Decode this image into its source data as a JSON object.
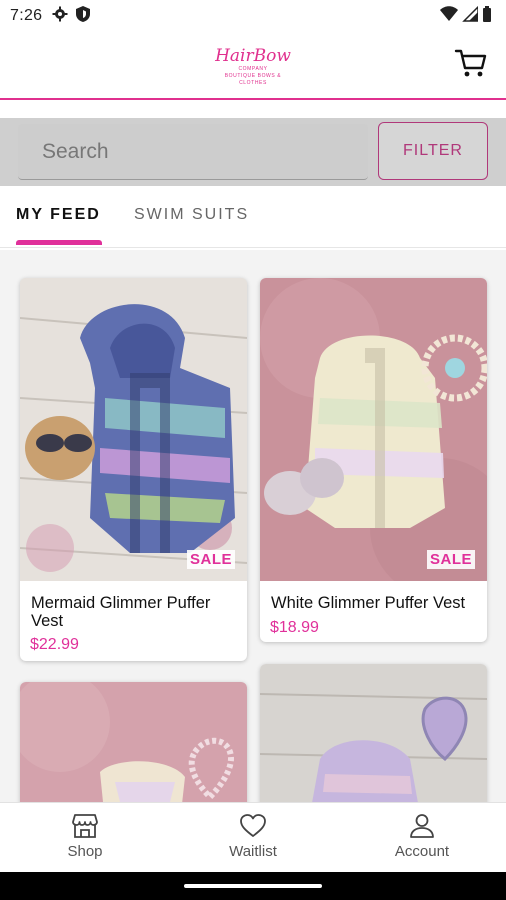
{
  "status_bar": {
    "time": "7:26"
  },
  "header": {
    "logo_line1": "HairBow",
    "logo_line2": "COMPANY",
    "logo_line3": "BOUTIQUE BOWS & CLOTHES"
  },
  "search": {
    "placeholder": "Search",
    "filter_label": "FILTER"
  },
  "tabs": [
    {
      "label": "MY FEED",
      "active": true
    },
    {
      "label": "SWIM SUITS",
      "active": false
    }
  ],
  "products": [
    {
      "name": "Mermaid Glimmer Puffer Vest",
      "price": "$22.99",
      "badge": "SALE"
    },
    {
      "name": "White Glimmer Puffer Vest",
      "price": "$18.99",
      "badge": "SALE"
    },
    {
      "name": "",
      "price": "",
      "badge": ""
    },
    {
      "name": "",
      "price": "",
      "badge": ""
    }
  ],
  "bottom_nav": [
    {
      "label": "Shop",
      "icon": "shop-icon"
    },
    {
      "label": "Waitlist",
      "icon": "heart-icon"
    },
    {
      "label": "Account",
      "icon": "account-icon"
    }
  ],
  "colors": {
    "accent": "#e0309a",
    "filter_border": "#b0387a"
  }
}
